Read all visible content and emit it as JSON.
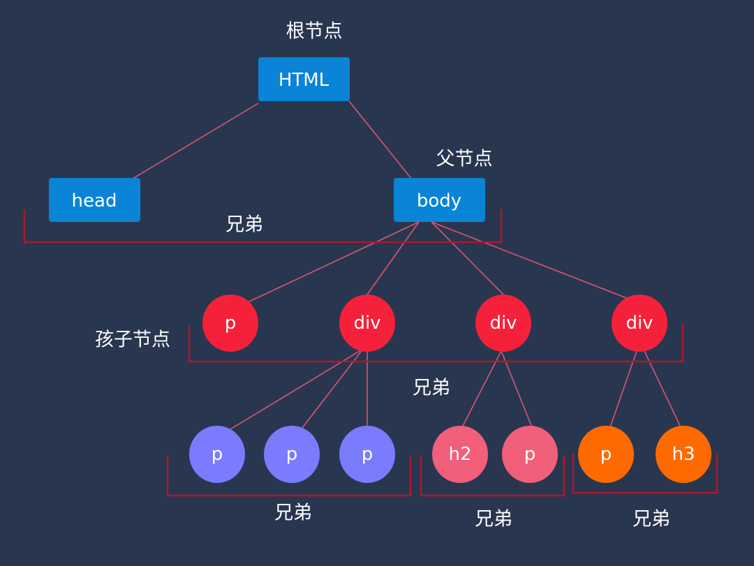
{
  "colors": {
    "background": "#293650",
    "box": "#0a84d6",
    "child_level": "#f5213a",
    "grandchild_group_1": "#7a7cfd",
    "grandchild_group_2": "#f25f7a",
    "grandchild_group_3": "#ff6a00",
    "edge": "#d9576f",
    "bracket": "#b0172a"
  },
  "labels": {
    "root": "根节点",
    "parent": "父节点",
    "siblings_top": "兄弟",
    "children": "孩子节点",
    "siblings_children": "兄弟",
    "siblings_group_1": "兄弟",
    "siblings_group_2": "兄弟",
    "siblings_group_3": "兄弟"
  },
  "nodes": {
    "html": "HTML",
    "head": "head",
    "body": "body",
    "child_1": "p",
    "child_2": "div",
    "child_3": "div",
    "child_4": "div",
    "gc_1": "p",
    "gc_2": "p",
    "gc_3": "p",
    "gc_4": "h2",
    "gc_5": "p",
    "gc_6": "p",
    "gc_7": "h3"
  }
}
